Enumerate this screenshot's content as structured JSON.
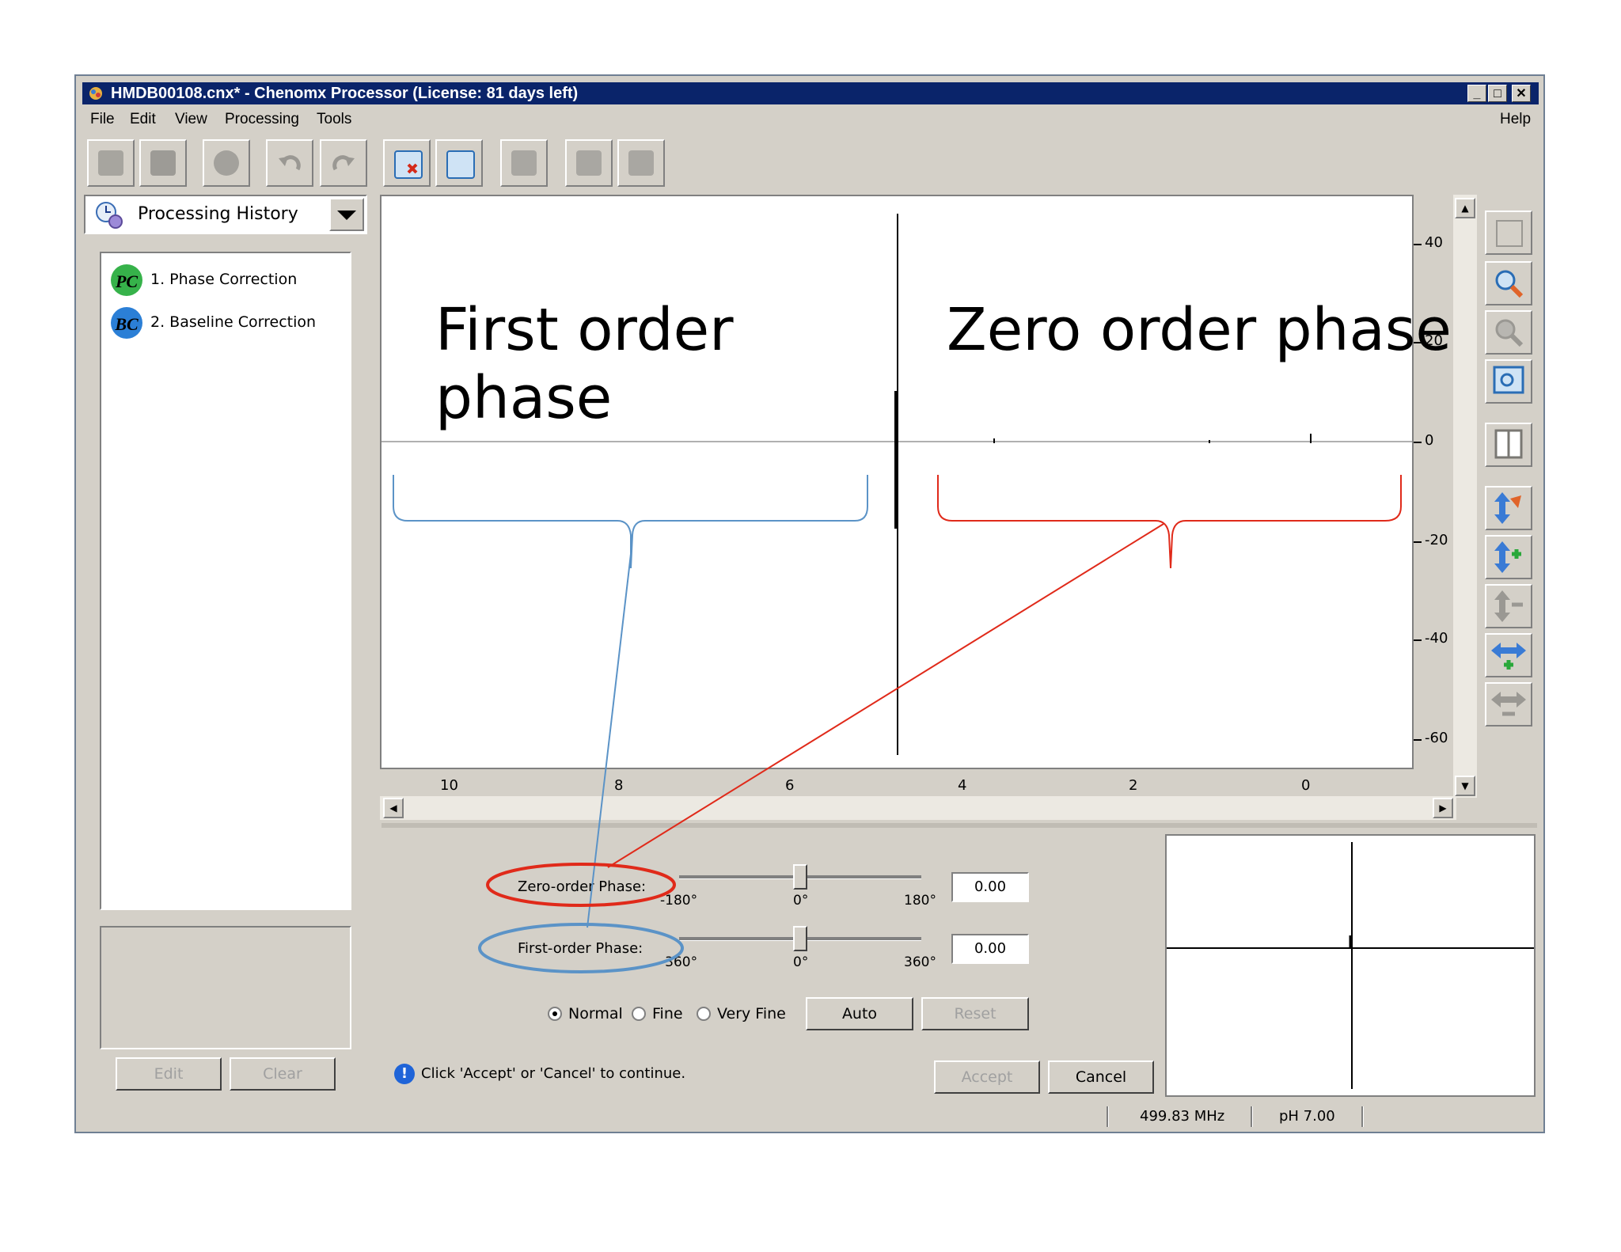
{
  "window": {
    "title": "HMDB00108.cnx* - Chenomx Processor (License: 81 days left)",
    "controls": [
      "_",
      "□",
      "✕"
    ]
  },
  "menu": {
    "items": [
      "File",
      "Edit",
      "View",
      "Processing",
      "Tools"
    ],
    "help": "Help"
  },
  "history_panel": {
    "title": "Processing History",
    "items": [
      {
        "badge": "PC",
        "label": "1.  Phase Correction"
      },
      {
        "badge": "BC",
        "label": "2.  Baseline Correction"
      }
    ],
    "edit_label": "Edit",
    "clear_label": "Clear"
  },
  "plot": {
    "x_ticks": [
      "10",
      "8",
      "6",
      "4",
      "2",
      "0"
    ],
    "y_ticks": [
      "40",
      "20",
      "0",
      "-20",
      "-40",
      "-60"
    ]
  },
  "phase_panel": {
    "zero_order_label": "Zero-order Phase:",
    "zero_order_min": "-180°",
    "zero_order_mid": "0°",
    "zero_order_max": "180°",
    "zero_order_value": "0.00",
    "first_order_label": "First-order Phase:",
    "first_order_min": "-360°",
    "first_order_mid": "0°",
    "first_order_max": "360°",
    "first_order_value": "0.00",
    "modes": [
      "Normal",
      "Fine",
      "Very Fine"
    ],
    "selected_mode": "Normal",
    "auto_label": "Auto",
    "reset_label": "Reset",
    "status_message": "Click 'Accept' or 'Cancel' to continue.",
    "accept_label": "Accept",
    "cancel_label": "Cancel"
  },
  "statusbar": {
    "frequency": "499.83 MHz",
    "ph": "pH 7.00"
  },
  "annotations": {
    "first_order_line1": "First order",
    "first_order_line2": "phase",
    "zero_order": "Zero order phase",
    "first_order_color": "#5b93c7",
    "zero_order_color": "#e02a1a"
  }
}
